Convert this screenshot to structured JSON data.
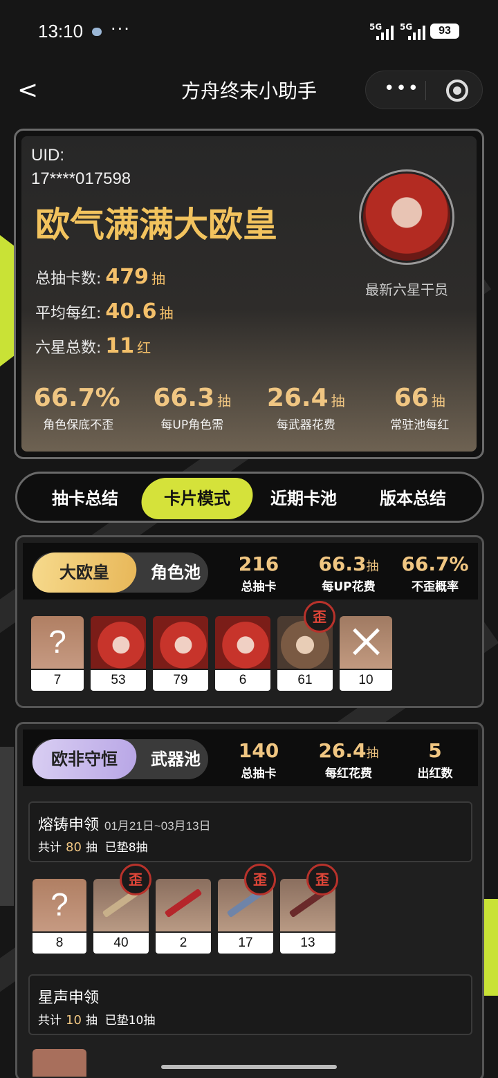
{
  "status": {
    "time": "13:10",
    "more": "···",
    "net1": "5G",
    "net2": "5G",
    "battery": "93"
  },
  "nav": {
    "back": "<",
    "title": "方舟终末小助手",
    "more": "•••"
  },
  "profile": {
    "uid_label": "UID:",
    "uid": "17****017598",
    "rank": "欧气满满大欧皇",
    "stats": [
      {
        "label": "总抽卡数:",
        "value": "479",
        "unit": "抽"
      },
      {
        "label": "平均每红:",
        "value": "40.6",
        "unit": "抽"
      },
      {
        "label": "六星总数:",
        "value": "11",
        "unit": "红"
      }
    ],
    "avatar_caption": "最新六星干员",
    "bottom": [
      {
        "value": "66.7%",
        "unit": "",
        "label": "角色保底不歪"
      },
      {
        "value": "66.3",
        "unit": "抽",
        "label": "每UP角色需"
      },
      {
        "value": "26.4",
        "unit": "抽",
        "label": "每武器花费"
      },
      {
        "value": "66",
        "unit": "抽",
        "label": "常驻池每红"
      }
    ]
  },
  "tabs": [
    "抽卡总结",
    "卡片模式",
    "近期卡池",
    "版本总结"
  ],
  "char_pool": {
    "badge": "大欧皇",
    "name": "角色池",
    "stats": [
      {
        "value": "216",
        "unit": "",
        "label": "总抽卡"
      },
      {
        "value": "66.3",
        "unit": "抽",
        "label": "每UP花费"
      },
      {
        "value": "66.7%",
        "unit": "",
        "label": "不歪概率"
      }
    ],
    "cards": [
      {
        "type": "unknown",
        "count": "7"
      },
      {
        "type": "redhair",
        "count": "53"
      },
      {
        "type": "redhair",
        "count": "79"
      },
      {
        "type": "redhair",
        "count": "6"
      },
      {
        "type": "brown",
        "count": "61",
        "wai": "歪"
      },
      {
        "type": "cross",
        "count": "10"
      }
    ]
  },
  "weapon_pool": {
    "badge": "欧非守恒",
    "name": "武器池",
    "stats": [
      {
        "value": "140",
        "unit": "",
        "label": "总抽卡"
      },
      {
        "value": "26.4",
        "unit": "抽",
        "label": "每红花费"
      },
      {
        "value": "5",
        "unit": "",
        "label": "出红数"
      }
    ],
    "banners": [
      {
        "name": "熔铸申领",
        "date": "01月21日~03月13日",
        "sub_prefix": "共计",
        "sub_count": "80",
        "sub_unit": "抽",
        "sub_rest": "已垫8抽"
      },
      {
        "name": "星声申领",
        "date": "",
        "sub_prefix": "共计",
        "sub_count": "10",
        "sub_unit": "抽",
        "sub_rest": "已垫10抽"
      }
    ],
    "cards": [
      {
        "type": "unknown",
        "count": "8"
      },
      {
        "type": "weapon",
        "count": "40",
        "wai": "歪"
      },
      {
        "type": "weapon red",
        "count": "2"
      },
      {
        "type": "weapon blue",
        "count": "17",
        "wai": "歪"
      },
      {
        "type": "weapon dark",
        "count": "13",
        "wai": "歪"
      }
    ]
  }
}
